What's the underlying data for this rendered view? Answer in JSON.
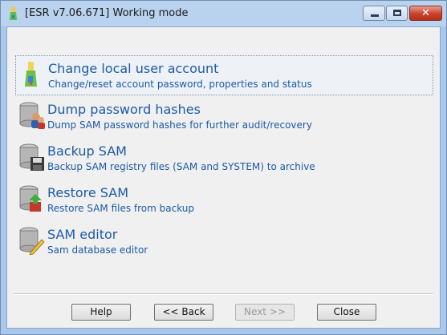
{
  "window": {
    "title": "[ESR v7.06.671]  Working mode"
  },
  "menu": {
    "items": [
      {
        "title": "Change local user account",
        "description": "Change/reset account password, properties and status",
        "icon": "user-account-icon"
      },
      {
        "title": "Dump password hashes",
        "description": "Dump SAM password hashes for further audit/recovery",
        "icon": "database-users-icon"
      },
      {
        "title": "Backup SAM",
        "description": "Backup SAM registry files (SAM and SYSTEM) to archive",
        "icon": "database-floppy-icon"
      },
      {
        "title": "Restore SAM",
        "description": "Restore SAM files from backup",
        "icon": "database-restore-icon"
      },
      {
        "title": "SAM editor",
        "description": "Sam database editor",
        "icon": "database-edit-icon"
      }
    ]
  },
  "buttons": {
    "help": "Help",
    "back": "<< Back",
    "next": "Next >>",
    "close": "Close"
  },
  "colors": {
    "item_text": "#1c5aa8",
    "frame": "#aac8ea",
    "close_button": "#c7402a"
  }
}
